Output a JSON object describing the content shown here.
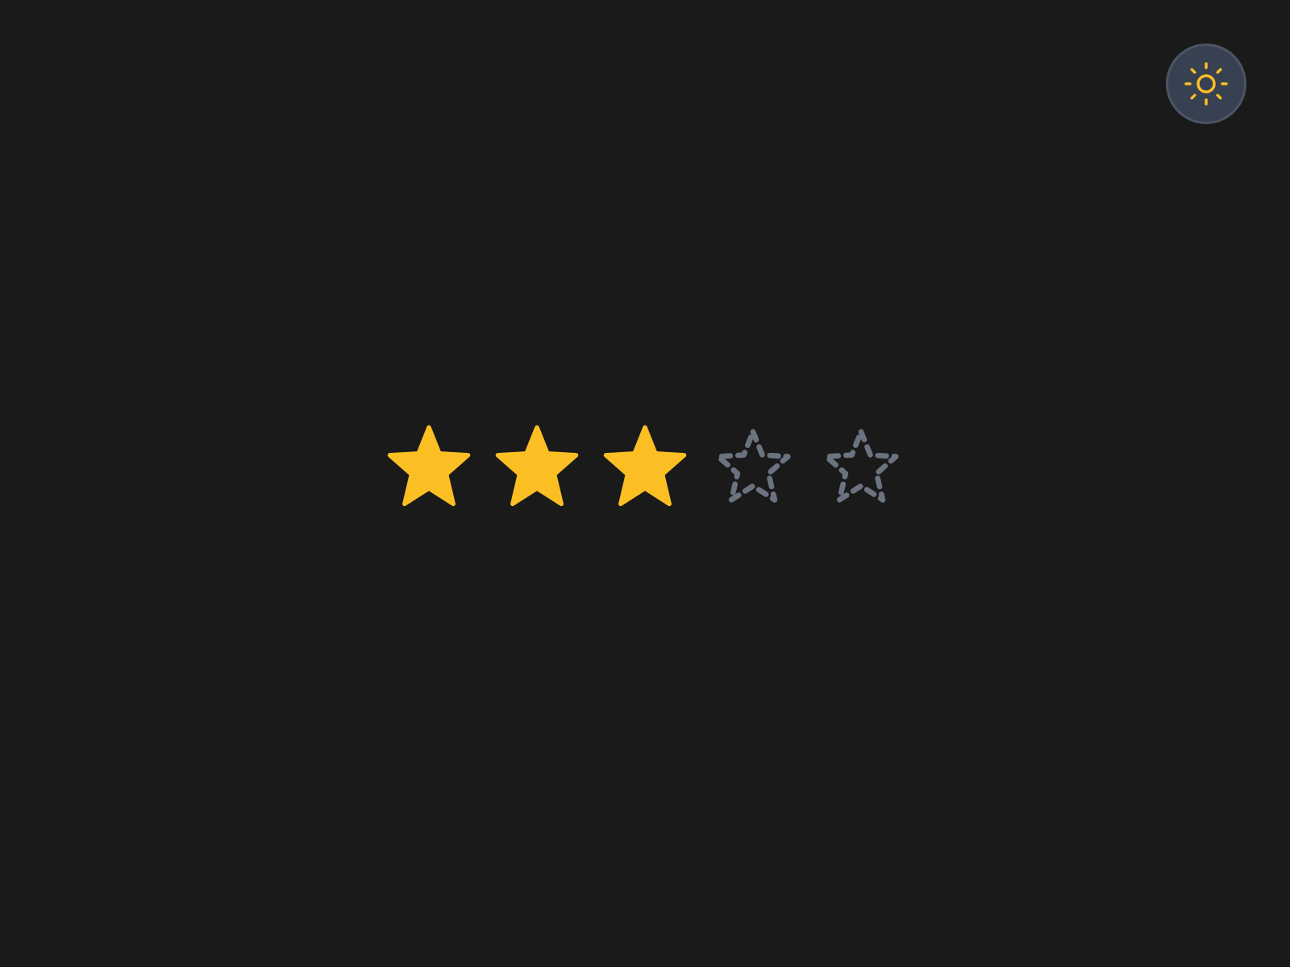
{
  "theme_toggle": {
    "icon": "sun-icon",
    "icon_color": "#fbbf24",
    "background": "#374151"
  },
  "rating": {
    "value": 3,
    "max": 5,
    "filled_color": "#fbbf24",
    "empty_color": "#6b7280"
  }
}
